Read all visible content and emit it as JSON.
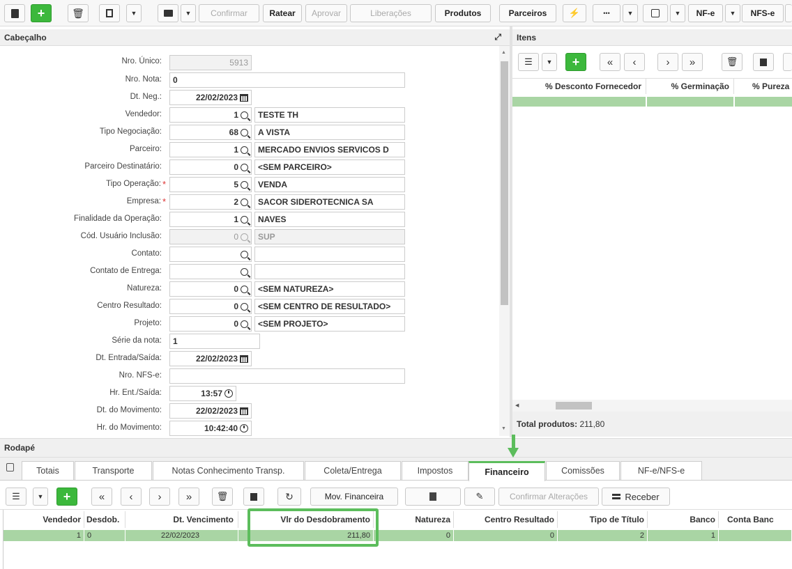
{
  "toolbar": {
    "confirmar": "Confirmar",
    "ratear": "Ratear",
    "aprovar": "Aprovar",
    "liberacoes": "Liberações",
    "produtos": "Produtos",
    "parceiros": "Parceiros",
    "more": "•••",
    "nfe": "NF-e",
    "nfse": "NFS-e",
    "add": "+"
  },
  "cabecalho": {
    "title": "Cabeçalho",
    "fields": {
      "nro_unico": {
        "label": "Nro. Único:",
        "value": "5913"
      },
      "nro_nota": {
        "label": "Nro. Nota:",
        "value": "0"
      },
      "dt_neg": {
        "label": "Dt. Neg.:",
        "value": "22/02/2023"
      },
      "vendedor": {
        "label": "Vendedor:",
        "code": "1",
        "desc": "TESTE TH"
      },
      "tipo_negociacao": {
        "label": "Tipo Negociação:",
        "code": "68",
        "desc": "A VISTA"
      },
      "parceiro": {
        "label": "Parceiro:",
        "code": "1",
        "desc": "MERCADO ENVIOS SERVICOS D"
      },
      "parceiro_destinatario": {
        "label": "Parceiro Destinatário:",
        "code": "0",
        "desc": "<SEM PARCEIRO>"
      },
      "tipo_operacao": {
        "label": "Tipo Operação:",
        "code": "5",
        "desc": "VENDA",
        "required": "*"
      },
      "empresa": {
        "label": "Empresa:",
        "code": "2",
        "desc": "SACOR SIDEROTECNICA SA",
        "required": "*"
      },
      "finalidade": {
        "label": "Finalidade da Operação:",
        "code": "1",
        "desc": "NAVES"
      },
      "cod_usuario": {
        "label": "Cód. Usuário Inclusão:",
        "code": "0",
        "desc": "SUP"
      },
      "contato": {
        "label": "Contato:",
        "code": "",
        "desc": ""
      },
      "contato_entrega": {
        "label": "Contato de Entrega:",
        "code": "",
        "desc": ""
      },
      "natureza": {
        "label": "Natureza:",
        "code": "0",
        "desc": "<SEM NATUREZA>"
      },
      "centro_resultado": {
        "label": "Centro Resultado:",
        "code": "0",
        "desc": "<SEM CENTRO DE RESULTADO>"
      },
      "projeto": {
        "label": "Projeto:",
        "code": "0",
        "desc": "<SEM PROJETO>"
      },
      "serie_nota": {
        "label": "Série da nota:",
        "value": "1"
      },
      "dt_entrada_saida": {
        "label": "Dt. Entrada/Saída:",
        "value": "22/02/2023"
      },
      "nro_nfse": {
        "label": "Nro. NFS-e:",
        "value": ""
      },
      "hr_ent_saida": {
        "label": "Hr. Ent./Saída:",
        "value": "13:57"
      },
      "dt_movimento": {
        "label": "Dt. do Movimento:",
        "value": "22/02/2023"
      },
      "hr_movimento": {
        "label": "Hr. do Movimento:",
        "value": "10:42:40"
      }
    }
  },
  "itens": {
    "title": "Itens",
    "columns": [
      "% Desconto Fornecedor",
      "% Germinação",
      "% Pureza"
    ],
    "total_label": "Total produtos:",
    "total_value": "211,80"
  },
  "rodape": {
    "title": "Rodapé",
    "tabs": [
      "Totais",
      "Transporte",
      "Notas Conhecimento Transp.",
      "Coleta/Entrega",
      "Impostos",
      "Financeiro",
      "Comissões",
      "NF-e/NFS-e"
    ],
    "active_tab": "Financeiro",
    "toolbar": {
      "mov_financeira": "Mov. Financeira",
      "confirmar_alteracoes": "Confirmar Alterações",
      "receber": "Receber"
    },
    "table": {
      "columns": [
        "Vendedor",
        "Desdob.",
        "Dt. Vencimento",
        "Vlr do Desdobramento",
        "Natureza",
        "Centro Resultado",
        "Tipo de Título",
        "Banco",
        "Conta Banc"
      ],
      "rows": [
        [
          "1",
          "0",
          "22/02/2023",
          "211,80",
          "0",
          "0",
          "2",
          "1",
          ""
        ]
      ]
    }
  },
  "colors": {
    "accent_green": "#3cb83c",
    "highlight": "#5cbd5c",
    "row_selected": "#a9d5a4"
  }
}
